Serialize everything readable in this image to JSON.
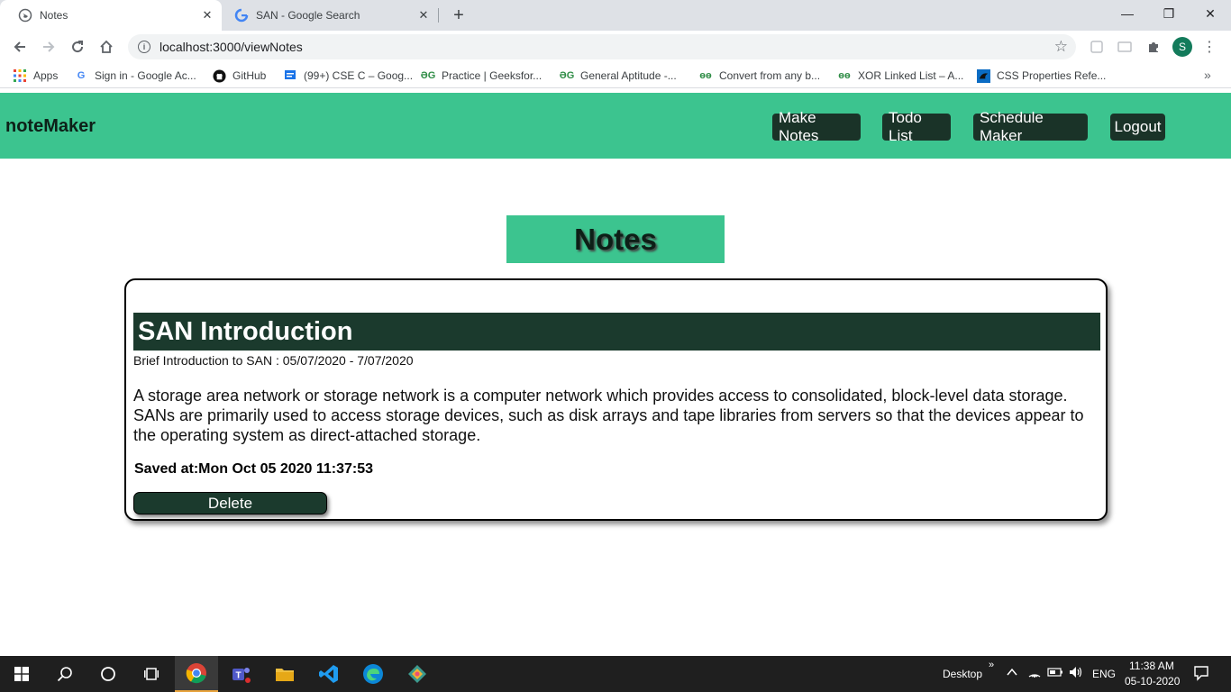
{
  "browser": {
    "tabs": [
      {
        "title": "Notes",
        "active": true
      },
      {
        "title": "SAN - Google Search",
        "active": false
      }
    ],
    "url": "localhost:3000/viewNotes",
    "profile_initial": "S",
    "bookmarks": [
      {
        "label": "Apps",
        "icon": "apps-grid-icon"
      },
      {
        "label": "Sign in - Google Ac...",
        "icon": "google-icon"
      },
      {
        "label": "GitHub",
        "icon": "github-icon"
      },
      {
        "label": "(99+) CSE C – Goog...",
        "icon": "chat-icon"
      },
      {
        "label": "Practice | Geeksfor...",
        "icon": "geeksforgeeks-icon"
      },
      {
        "label": "General Aptitude -...",
        "icon": "geeksforgeeks-icon"
      },
      {
        "label": "Convert from any b...",
        "icon": "geeksforgeeks-icon"
      },
      {
        "label": "XOR Linked List – A...",
        "icon": "geeksforgeeks-icon"
      },
      {
        "label": "CSS Properties Refe...",
        "icon": "bird-icon"
      }
    ]
  },
  "app": {
    "brand": "noteMaker",
    "nav": [
      "Make Notes",
      "Todo List",
      "Schedule Maker",
      "Logout"
    ],
    "heading": "Notes",
    "colors": {
      "primary": "#3cc48f",
      "dark": "#1b3a2d"
    }
  },
  "note": {
    "title": "SAN Introduction",
    "subtitle": "Brief Introduction to SAN : 05/07/2020 - 7/07/2020",
    "body": "A storage area network or storage network is a computer network which provides access to consolidated, block-level data storage. SANs are primarily used to access storage devices, such as disk arrays and tape libraries from servers so that the devices appear to the operating system as direct-attached storage.",
    "saved": "Saved at:Mon Oct 05 2020 11:37:53",
    "delete_label": "Delete"
  },
  "taskbar": {
    "desktop_label": "Desktop",
    "lang": "ENG",
    "time": "11:38 AM",
    "date": "05-10-2020"
  }
}
